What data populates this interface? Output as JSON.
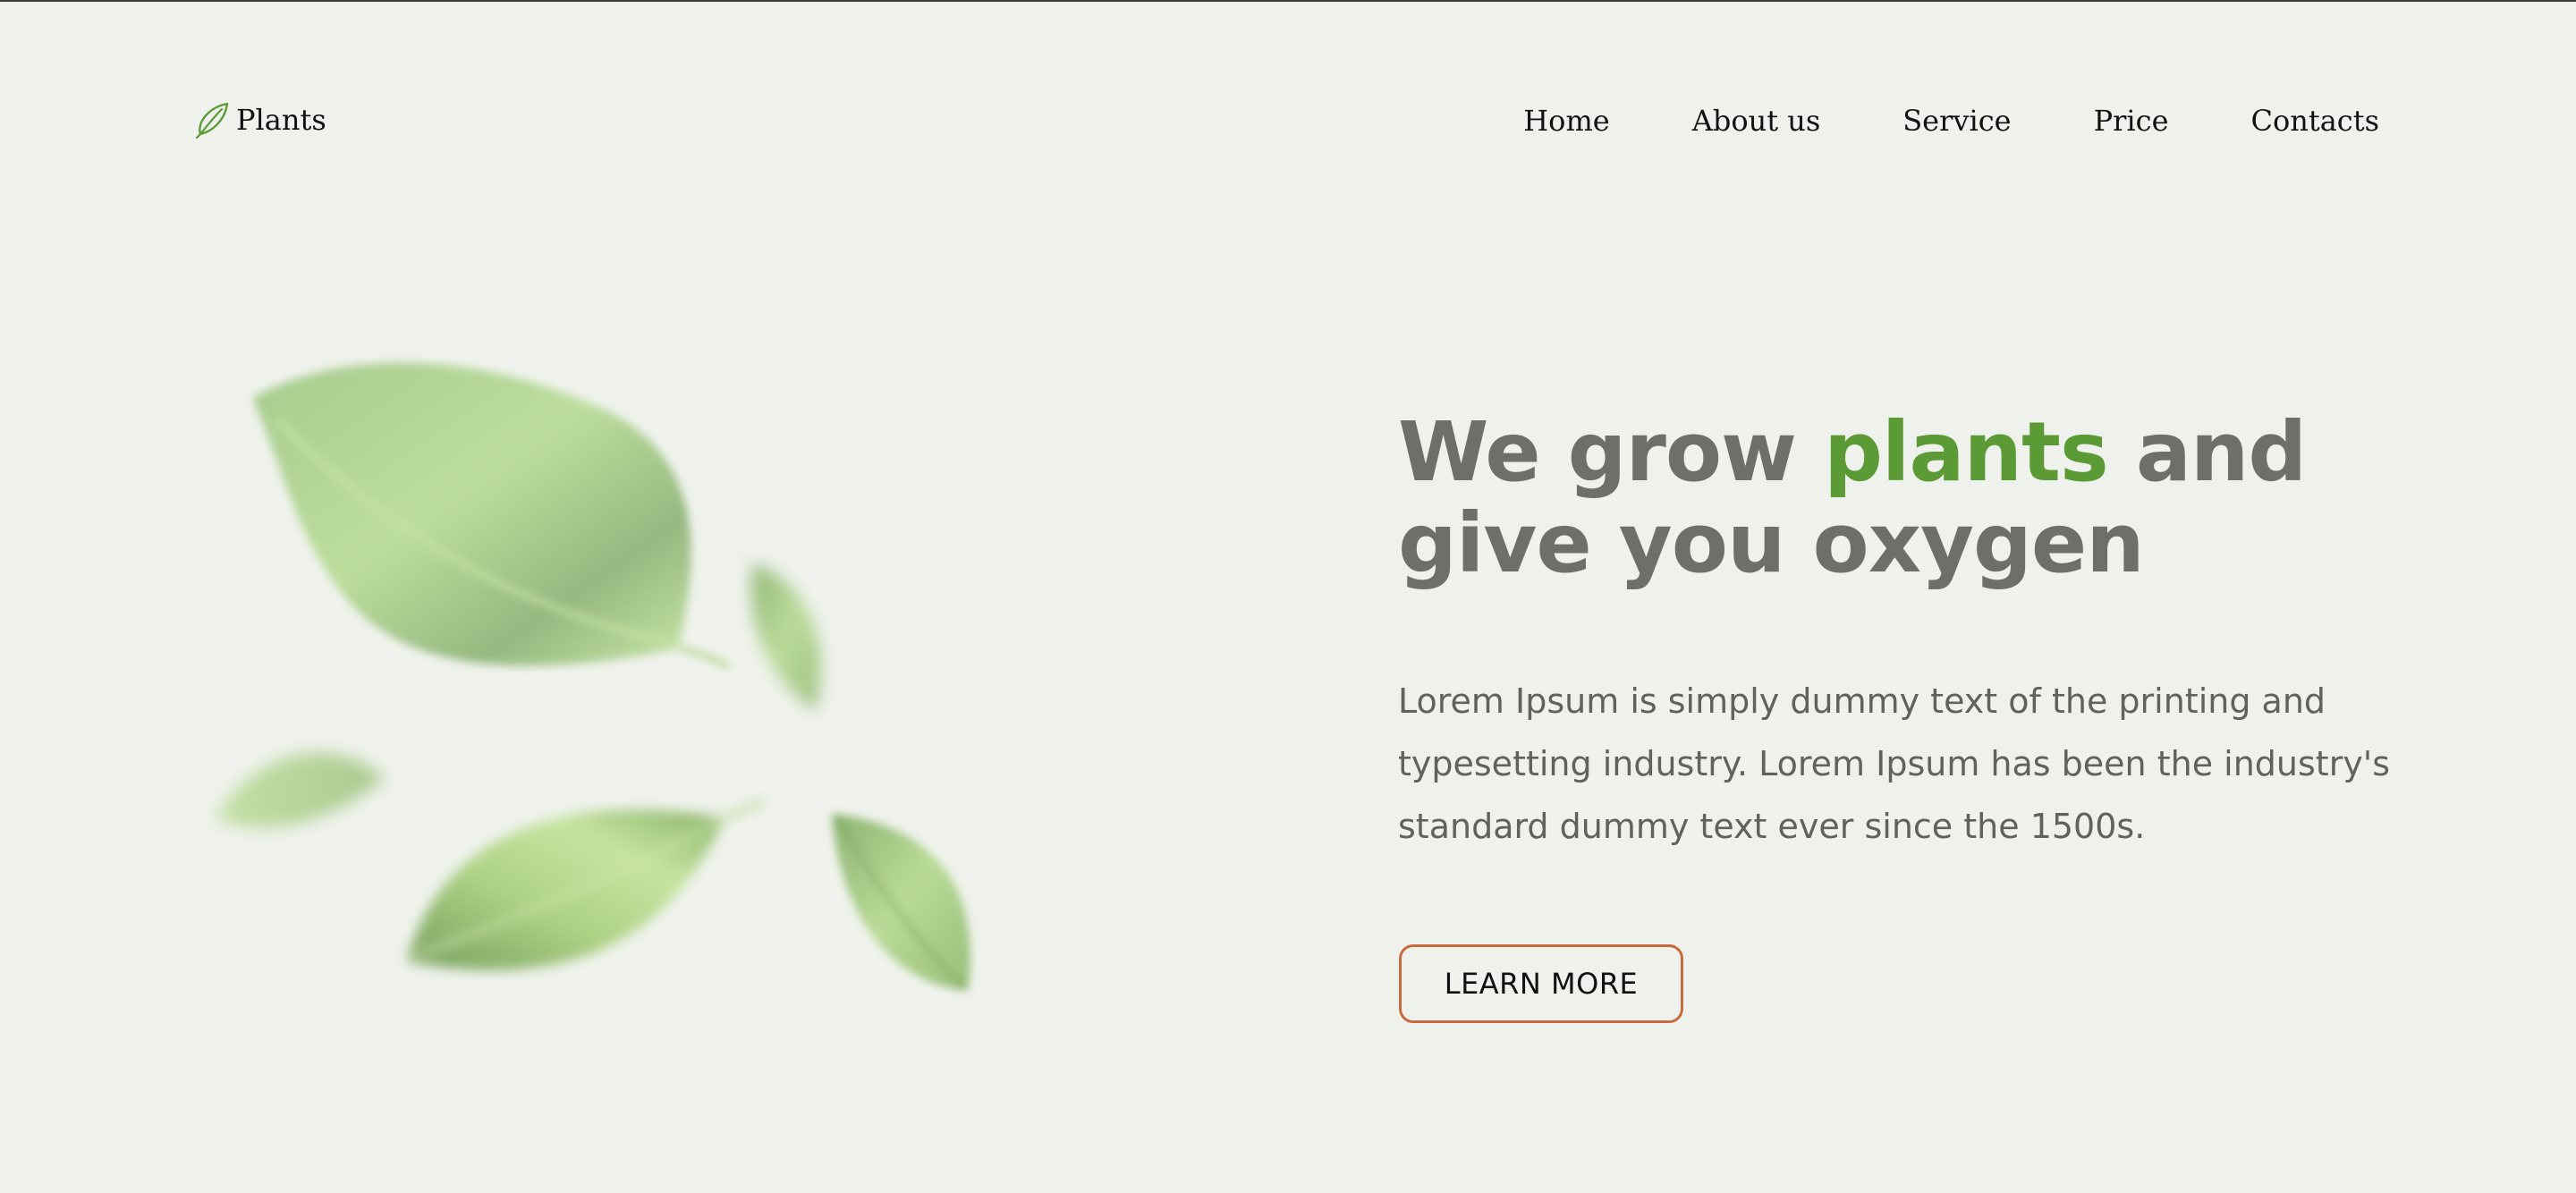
{
  "brand": {
    "name": "Plants",
    "icon": "leaf-icon",
    "accent_color": "#5c9a36"
  },
  "nav": {
    "items": [
      {
        "label": "Home"
      },
      {
        "label": "About us"
      },
      {
        "label": "Service"
      },
      {
        "label": "Price"
      },
      {
        "label": "Contacts"
      }
    ]
  },
  "hero": {
    "title_before": "We grow ",
    "title_highlight": "plants",
    "title_after": " and give you oxygen",
    "body": "Lorem Ipsum is simply dummy text of the printing and typesetting industry. Lorem Ipsum has been the industry's standard dummy text ever since the 1500s.",
    "cta_label": "LEARN MORE",
    "cta_border_color": "#c96a3e",
    "title_color": "#6d6f6b"
  },
  "colors": {
    "background": "#eff2ec"
  }
}
